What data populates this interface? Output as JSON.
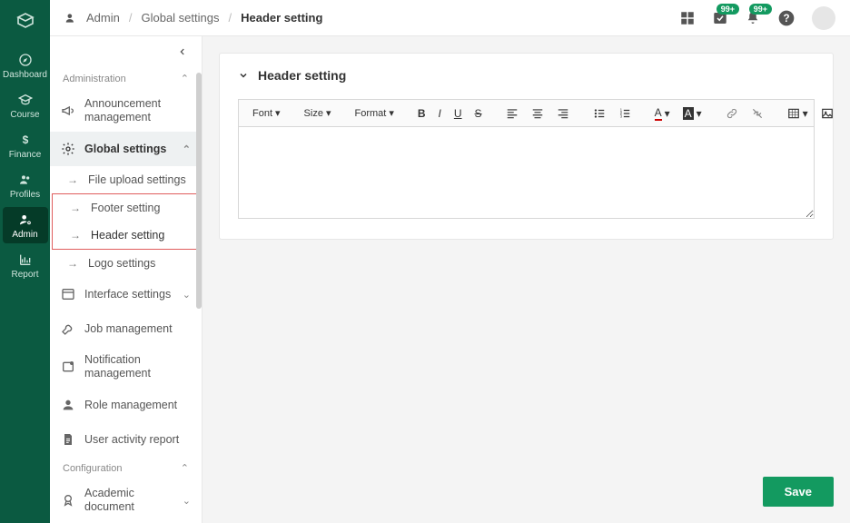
{
  "rail": {
    "items": [
      {
        "id": "dashboard",
        "label": "Dashboard"
      },
      {
        "id": "course",
        "label": "Course"
      },
      {
        "id": "finance",
        "label": "Finance"
      },
      {
        "id": "profiles",
        "label": "Profiles"
      },
      {
        "id": "admin",
        "label": "Admin"
      },
      {
        "id": "report",
        "label": "Report"
      }
    ]
  },
  "header": {
    "crumbs": {
      "root": "Admin",
      "mid": "Global settings",
      "current": "Header setting"
    },
    "badges": {
      "tasks": "99+",
      "notifications": "99+"
    }
  },
  "sidenav": {
    "section_admin": "Administration",
    "items": {
      "announcements": "Announcement management",
      "global": "Global settings",
      "interface": "Interface settings",
      "job": "Job management",
      "notification": "Notification management",
      "role": "Role management",
      "activity": "User activity report"
    },
    "global_sub": {
      "upload": "File upload settings",
      "footer": "Footer setting",
      "header": "Header setting",
      "logo": "Logo settings"
    },
    "section_config": "Configuration",
    "config_items": {
      "academic": "Academic document"
    }
  },
  "panel": {
    "title": "Header setting"
  },
  "toolbar": {
    "font": "Font",
    "size": "Size",
    "format": "Format"
  },
  "actions": {
    "save": "Save"
  }
}
